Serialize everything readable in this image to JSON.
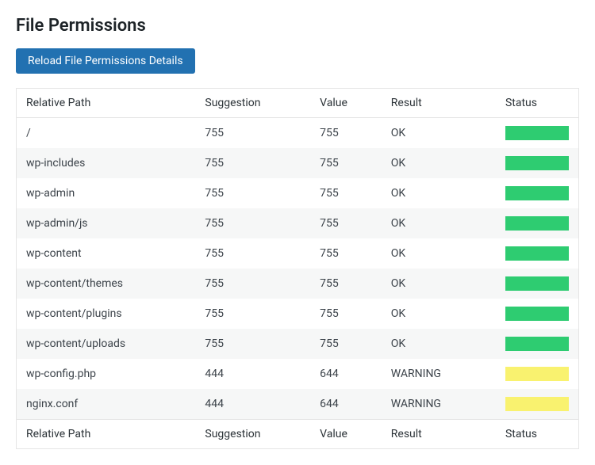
{
  "page": {
    "title": "File Permissions"
  },
  "buttons": {
    "reload_label": "Reload File Permissions Details"
  },
  "table": {
    "headers": {
      "path": "Relative Path",
      "suggestion": "Suggestion",
      "value": "Value",
      "result": "Result",
      "status": "Status"
    },
    "footers": {
      "path": "Relative Path",
      "suggestion": "Suggestion",
      "value": "Value",
      "result": "Result",
      "status": "Status"
    },
    "rows": [
      {
        "path": "/",
        "suggestion": "755",
        "value": "755",
        "result": "OK",
        "status": "ok"
      },
      {
        "path": "wp-includes",
        "suggestion": "755",
        "value": "755",
        "result": "OK",
        "status": "ok"
      },
      {
        "path": "wp-admin",
        "suggestion": "755",
        "value": "755",
        "result": "OK",
        "status": "ok"
      },
      {
        "path": "wp-admin/js",
        "suggestion": "755",
        "value": "755",
        "result": "OK",
        "status": "ok"
      },
      {
        "path": "wp-content",
        "suggestion": "755",
        "value": "755",
        "result": "OK",
        "status": "ok"
      },
      {
        "path": "wp-content/themes",
        "suggestion": "755",
        "value": "755",
        "result": "OK",
        "status": "ok"
      },
      {
        "path": "wp-content/plugins",
        "suggestion": "755",
        "value": "755",
        "result": "OK",
        "status": "ok"
      },
      {
        "path": "wp-content/uploads",
        "suggestion": "755",
        "value": "755",
        "result": "OK",
        "status": "ok"
      },
      {
        "path": "wp-config.php",
        "suggestion": "444",
        "value": "644",
        "result": "WARNING",
        "status": "warning"
      },
      {
        "path": "nginx.conf",
        "suggestion": "444",
        "value": "644",
        "result": "WARNING",
        "status": "warning"
      }
    ]
  },
  "status_colors": {
    "ok": "#2ecc71",
    "warning": "#f9f26f"
  }
}
